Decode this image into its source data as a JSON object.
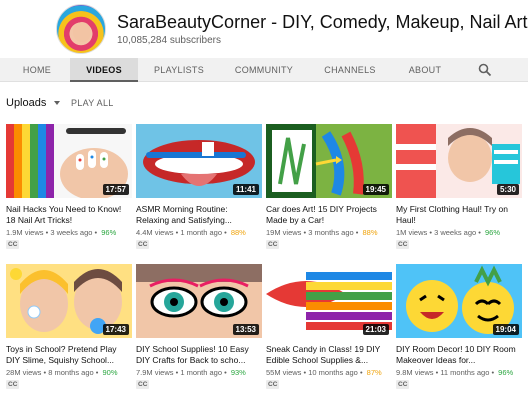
{
  "channel": {
    "title": "SaraBeautyCorner - DIY, Comedy, Makeup, Nail Art",
    "verified_glyph": "✓",
    "subscribers": "10,085,284 subscribers"
  },
  "tabs": [
    {
      "label": "HOME",
      "active": false
    },
    {
      "label": "VIDEOS",
      "active": true
    },
    {
      "label": "PLAYLISTS",
      "active": false
    },
    {
      "label": "COMMUNITY",
      "active": false
    },
    {
      "label": "CHANNELS",
      "active": false
    },
    {
      "label": "ABOUT",
      "active": false
    }
  ],
  "toolbar": {
    "sort_label": "Uploads",
    "play_all": "PLAY ALL"
  },
  "colors": {
    "rating_green": "#2ba640",
    "rating_orange": "#f0a30a",
    "search_icon": "search-icon"
  },
  "videos": [
    {
      "title": "Nail Hacks You Need to Know! 18 Nail Art Tricks!",
      "views": "1.9M views",
      "age": "3 weeks ago",
      "rating": "96%",
      "rating_color": "#2ba640",
      "duration": "17:57",
      "cc": "CC"
    },
    {
      "title": "ASMR Morning Routine: Relaxing and Satisfying...",
      "views": "4.4M views",
      "age": "1 month ago",
      "rating": "88%",
      "rating_color": "#f0a30a",
      "duration": "11:41",
      "cc": "CC"
    },
    {
      "title": "Car does Art! 15 DIY Projects Made by a Car!",
      "views": "19M views",
      "age": "3 months ago",
      "rating": "88%",
      "rating_color": "#f0a30a",
      "duration": "19:45",
      "cc": "CC"
    },
    {
      "title": "My First Clothing Haul! Try on Haul!",
      "views": "1M views",
      "age": "3 weeks ago",
      "rating": "96%",
      "rating_color": "#2ba640",
      "duration": "5:30",
      "cc": "CC"
    },
    {
      "title": "Toys in School? Pretend Play DIY Slime, Squishy School...",
      "views": "28M views",
      "age": "8 months ago",
      "rating": "90%",
      "rating_color": "#2ba640",
      "duration": "17:43",
      "cc": "CC"
    },
    {
      "title": "DIY School Supplies! 10 Easy DIY Crafts for Back to scho...",
      "views": "7.9M views",
      "age": "1 month ago",
      "rating": "93%",
      "rating_color": "#2ba640",
      "duration": "13:53",
      "cc": "CC"
    },
    {
      "title": "Sneak Candy in Class! 19 DIY Edible School Supplies &...",
      "views": "55M views",
      "age": "10 months ago",
      "rating": "87%",
      "rating_color": "#f0a30a",
      "duration": "21:03",
      "cc": "CC"
    },
    {
      "title": "DIY Room Decor! 10 DIY Room Makeover Ideas for...",
      "views": "9.8M views",
      "age": "11 months ago",
      "rating": "96%",
      "rating_color": "#2ba640",
      "duration": "19:04",
      "cc": "CC"
    }
  ]
}
